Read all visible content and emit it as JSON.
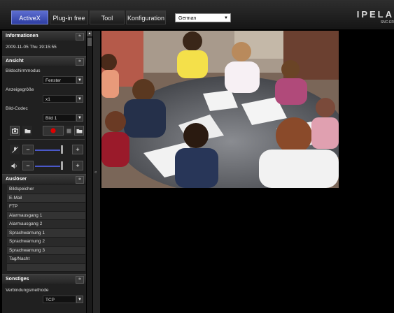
{
  "header": {
    "tabs": [
      {
        "label": "ActiveX",
        "active": true
      },
      {
        "label": "Plug-in free",
        "active": false
      },
      {
        "label": "Tool",
        "active": false
      },
      {
        "label": "Konfiguration",
        "active": false
      }
    ],
    "language": "German",
    "logo": "IPELA",
    "model": "SNC-ER"
  },
  "info": {
    "title": "Informationen",
    "datetime": "2009-11-05 Thu 19:15:55"
  },
  "view": {
    "title": "Ansicht",
    "screen_mode_label": "Bildschirmmodus",
    "screen_mode_value": "Fenster",
    "display_size_label": "Anzeigegröße",
    "display_size_value": "x1",
    "codec_label": "Bild-Codec",
    "codec_value": "Bild 1"
  },
  "trigger": {
    "title": "Auslöser",
    "items": [
      "Bildspeicher",
      "E-Mail",
      "FTP",
      "Alarmausgang 1",
      "Alarmausgang 2",
      "Sprachwarnung 1",
      "Sprachwarnung 2",
      "Sprachwarnung 3",
      "Tag/Nacht"
    ]
  },
  "other": {
    "title": "Sonstiges",
    "connection_label": "Verbindungsmethode",
    "connection_value": "TCP"
  },
  "controls": {
    "minus": "−",
    "plus": "+",
    "collapse": "≈",
    "dropdown_arrow": "▼",
    "scroll_up": "▲",
    "splitter_arrow": "«"
  },
  "colors": {
    "accent": "#4a58c8",
    "active_tab": "#3c4cb8",
    "record": "#e00000"
  }
}
